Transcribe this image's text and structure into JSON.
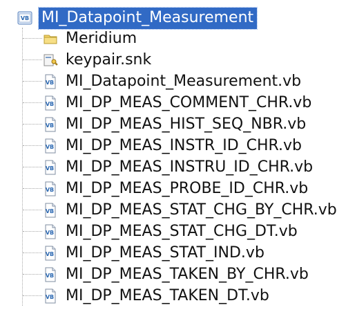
{
  "tree": {
    "root": {
      "label": "MI_Datapoint_Measurement",
      "icon": "vb-project-icon"
    },
    "items": [
      {
        "label": "Meridium",
        "icon": "folder-icon"
      },
      {
        "label": "keypair.snk",
        "icon": "key-file-icon"
      },
      {
        "label": "MI_Datapoint_Measurement.vb",
        "icon": "vb-file-icon"
      },
      {
        "label": "MI_DP_MEAS_COMMENT_CHR.vb",
        "icon": "vb-file-icon"
      },
      {
        "label": "MI_DP_MEAS_HIST_SEQ_NBR.vb",
        "icon": "vb-file-icon"
      },
      {
        "label": "MI_DP_MEAS_INSTR_ID_CHR.vb",
        "icon": "vb-file-icon"
      },
      {
        "label": "MI_DP_MEAS_INSTRU_ID_CHR.vb",
        "icon": "vb-file-icon"
      },
      {
        "label": "MI_DP_MEAS_PROBE_ID_CHR.vb",
        "icon": "vb-file-icon"
      },
      {
        "label": "MI_DP_MEAS_STAT_CHG_BY_CHR.vb",
        "icon": "vb-file-icon"
      },
      {
        "label": "MI_DP_MEAS_STAT_CHG_DT.vb",
        "icon": "vb-file-icon"
      },
      {
        "label": "MI_DP_MEAS_STAT_IND.vb",
        "icon": "vb-file-icon"
      },
      {
        "label": "MI_DP_MEAS_TAKEN_BY_CHR.vb",
        "icon": "vb-file-icon"
      },
      {
        "label": "MI_DP_MEAS_TAKEN_DT.vb",
        "icon": "vb-file-icon"
      }
    ]
  },
  "colors": {
    "selection": "#316ac5",
    "folder": "#f4d36c",
    "vb_blue": "#2a67b1",
    "tree_line": "#a8a8a8"
  }
}
